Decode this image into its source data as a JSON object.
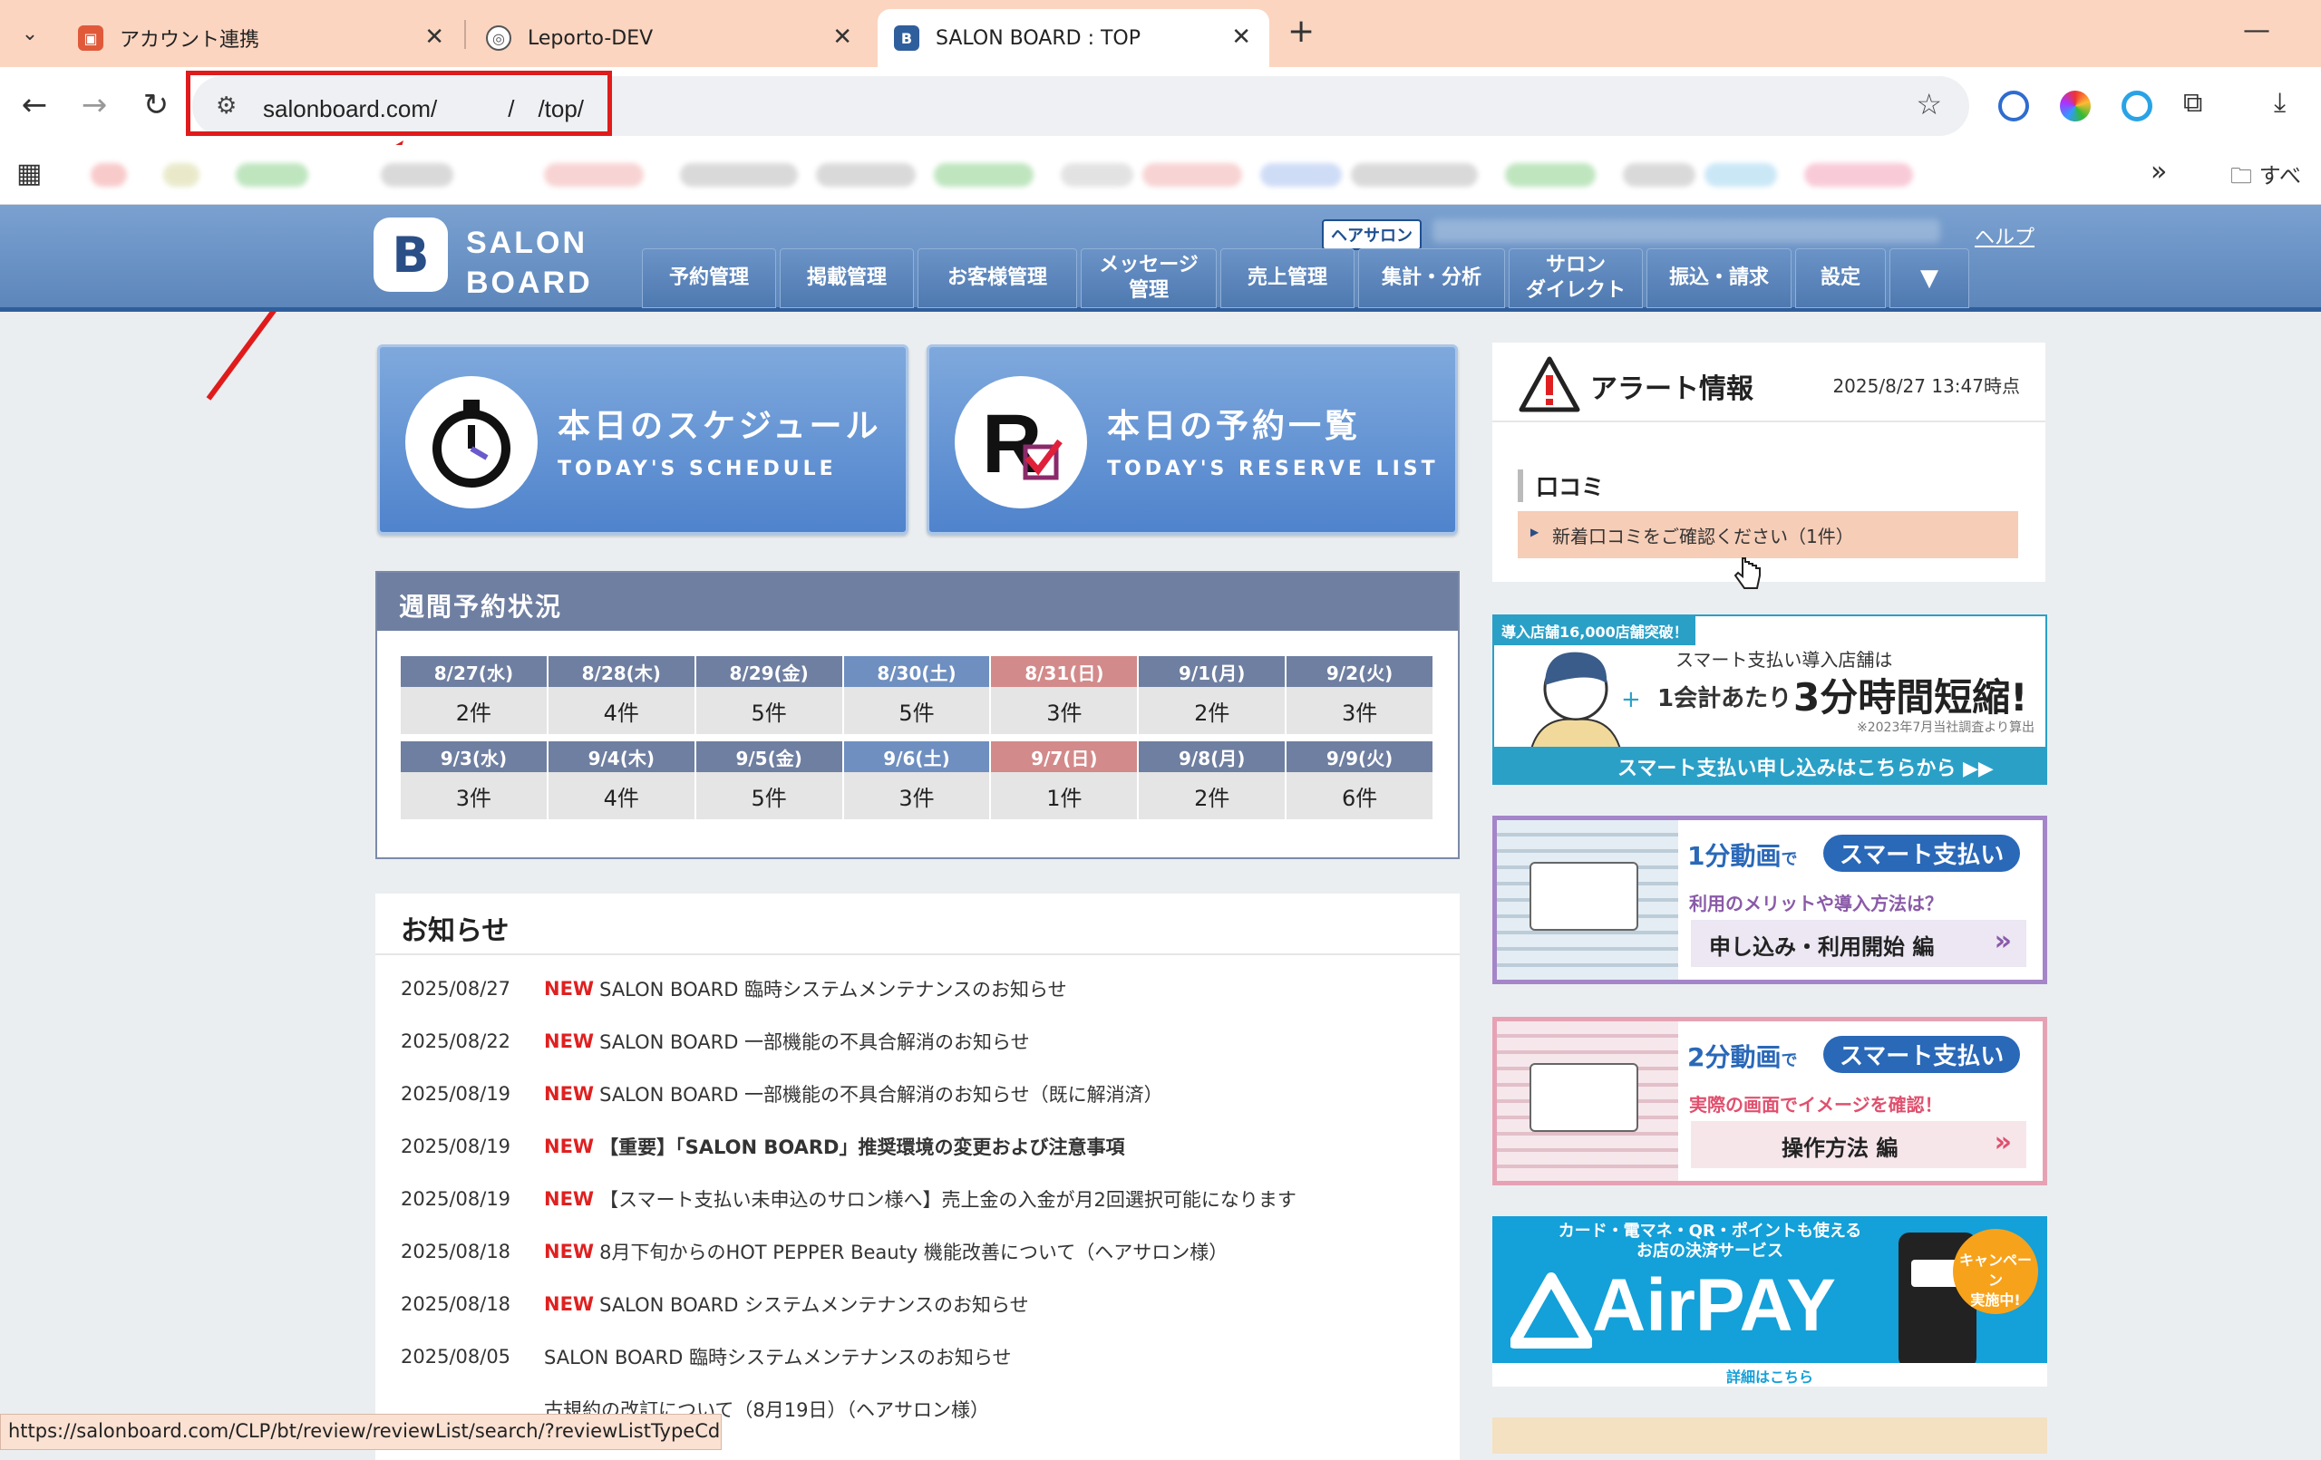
{
  "browser": {
    "tabs": [
      {
        "title": "アカウント連携"
      },
      {
        "title": "Leporto-DEV"
      },
      {
        "title": "SALON BOARD : TOP"
      }
    ],
    "address": "salonboard.com/　　　/　/top/",
    "bookmarks_more": "»",
    "bookmarks_folder": "すべて"
  },
  "header": {
    "brand_line1": "SALON",
    "brand_line2": "BOARD",
    "hair_salon_badge": "ヘアサロン",
    "help": "ヘルプ",
    "nav": [
      "予約管理",
      "掲載管理",
      "お客様管理",
      "メッセージ\n管理",
      "売上管理",
      "集計・分析",
      "サロン\nダイレクト",
      "振込・請求",
      "設定"
    ]
  },
  "quick_buttons": {
    "schedule": {
      "jp": "本日のスケジュール",
      "en": "TODAY'S SCHEDULE"
    },
    "reserve": {
      "jp": "本日の予約一覧",
      "en": "TODAY'S RESERVE LIST"
    }
  },
  "weekly": {
    "title": "週間予約状況",
    "rows": [
      {
        "days": [
          "8/27(水)",
          "8/28(木)",
          "8/29(金)",
          "8/30(土)",
          "8/31(日)",
          "9/1(月)",
          "9/2(火)"
        ],
        "counts": [
          "2件",
          "4件",
          "5件",
          "5件",
          "3件",
          "2件",
          "3件"
        ]
      },
      {
        "days": [
          "9/3(水)",
          "9/4(木)",
          "9/5(金)",
          "9/6(土)",
          "9/7(日)",
          "9/8(月)",
          "9/9(火)"
        ],
        "counts": [
          "3件",
          "4件",
          "5件",
          "3件",
          "1件",
          "2件",
          "6件"
        ]
      }
    ],
    "colors": {
      "weekday": "#6f7fa1",
      "saturday": "#6e8fc0",
      "sunday": "#d38a8a"
    }
  },
  "news": {
    "title": "お知らせ",
    "new_label": "NEW",
    "items": [
      {
        "date": "2025/08/27",
        "is_new": true,
        "text": "SALON BOARD 臨時システムメンテナンスのお知らせ"
      },
      {
        "date": "2025/08/22",
        "is_new": true,
        "text": "SALON BOARD 一部機能の不具合解消のお知らせ"
      },
      {
        "date": "2025/08/19",
        "is_new": true,
        "text": "SALON BOARD 一部機能の不具合解消のお知らせ（既に解消済）"
      },
      {
        "date": "2025/08/19",
        "is_new": true,
        "text": "【重要】「SALON BOARD」推奨環境の変更および注意事項"
      },
      {
        "date": "2025/08/19",
        "is_new": true,
        "text": "【スマート支払い未申込のサロン様へ】売上金の入金が月2回選択可能になります"
      },
      {
        "date": "2025/08/18",
        "is_new": true,
        "text": "8月下旬からのHOT PEPPER Beauty 機能改善について（ヘアサロン様）"
      },
      {
        "date": "2025/08/18",
        "is_new": true,
        "text": "SALON BOARD システムメンテナンスのお知らせ"
      },
      {
        "date": "2025/08/05",
        "is_new": false,
        "text": "SALON BOARD 臨時システムメンテナンスのお知らせ"
      },
      {
        "date": "",
        "is_new": false,
        "text": "古規約の改訂について（8月19日）（ヘアサロン様）"
      }
    ]
  },
  "status_url": "https://salonboard.com/CLP/bt/review/reviewList/search/?reviewListTypeCd=1",
  "alert": {
    "title": "アラート情報",
    "time": "2025/8/27 13:47時点",
    "section": "口コミ",
    "link": "新着口コミをご確認ください（1件）"
  },
  "banners": {
    "b1": {
      "top": "導入店舗16,000店舗突破！",
      "line1": "スマート支払い導入店舗は",
      "line2a": "1会計あたり",
      "line2b": "3分時間短縮!",
      "note": "※2023年7月当社調査より算出",
      "cta": "スマート支払い申し込みはこちらから ▶▶"
    },
    "b2": {
      "title_a": "1分動画",
      "title_b": "で",
      "pill": "スマート支払い",
      "sub": "利用のメリットや導入方法は？",
      "cta": "申し込み・利用開始 編"
    },
    "b3": {
      "title_a": "2分動画",
      "title_b": "で",
      "pill": "スマート支払い",
      "sub": "実際の画面でイメージを確認！",
      "cta": "操作方法 編"
    },
    "b4": {
      "top": "カード・電マネ・QR・ポイントも使える\nお店の決済サービス",
      "brand": "AirPAY",
      "badge": "キャンペーン\n実施中!",
      "link": "詳細はこちら"
    }
  }
}
